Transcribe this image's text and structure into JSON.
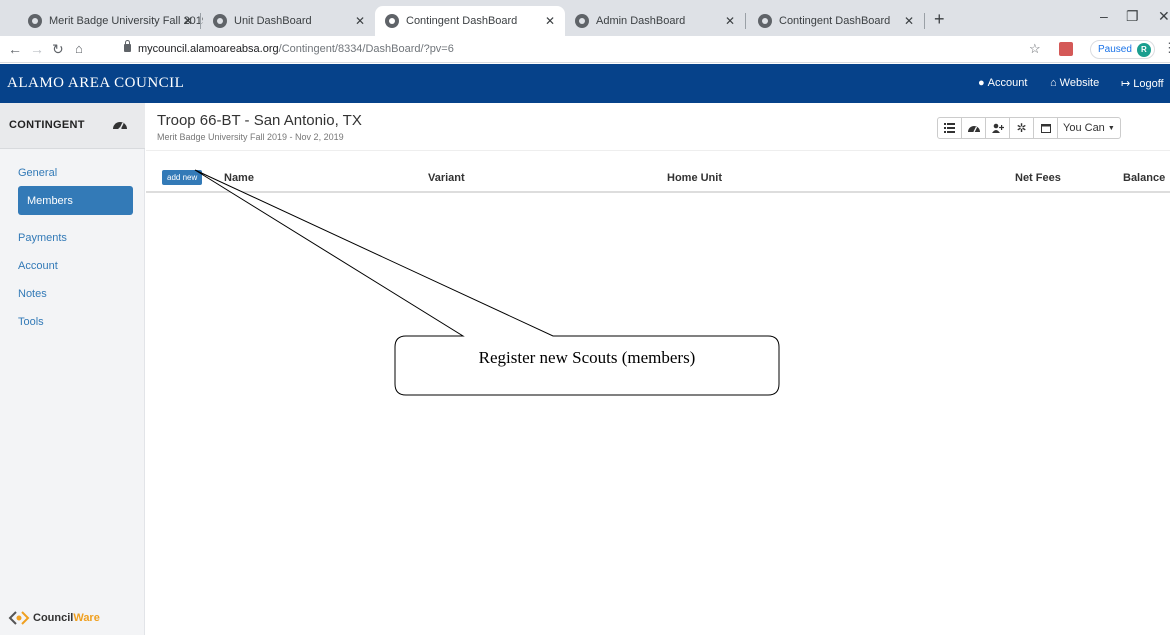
{
  "browser": {
    "tabs": [
      {
        "title": "Merit Badge University Fall 2019",
        "active": false
      },
      {
        "title": "Unit DashBoard",
        "active": false
      },
      {
        "title": "Contingent DashBoard",
        "active": true
      },
      {
        "title": "Admin DashBoard",
        "active": false
      },
      {
        "title": "Contingent DashBoard",
        "active": false
      }
    ],
    "url_host": "mycouncil.alamoareabsa.org",
    "url_path": "/Contingent/8334/DashBoard/?pv=6",
    "profile_status": "Paused",
    "profile_initial": "R"
  },
  "header": {
    "brand": "ALAMO AREA COUNCIL",
    "links": [
      {
        "label": "Account",
        "icon": "user-circle-icon"
      },
      {
        "label": "Website",
        "icon": "home-icon"
      },
      {
        "label": "Logoff",
        "icon": "logout-icon"
      }
    ],
    "brand_color": "#06428a"
  },
  "sidebar": {
    "title": "CONTINGENT",
    "items": [
      {
        "label": "General",
        "active": false
      },
      {
        "label": "Members",
        "active": true
      },
      {
        "label": "Payments",
        "active": false
      },
      {
        "label": "Account",
        "active": false
      },
      {
        "label": "Notes",
        "active": false
      },
      {
        "label": "Tools",
        "active": false
      }
    ],
    "logo_council": "Council",
    "logo_ware": "Ware"
  },
  "main": {
    "title": "Troop 66-BT - San Antonio, TX",
    "subtitle": "Merit Badge University Fall 2019 - Nov 2, 2019",
    "toolbar": {
      "icons": [
        "list-icon",
        "dashboard-icon",
        "add-user-icon",
        "gear-icon",
        "calendar-icon"
      ],
      "dropdown_label": "You Can"
    },
    "table": {
      "add_button": "add new",
      "columns": [
        "Name",
        "Variant",
        "Home Unit",
        "Net Fees",
        "Balance"
      ]
    }
  },
  "annotation": {
    "callout_text": "Register new Scouts (members)"
  }
}
